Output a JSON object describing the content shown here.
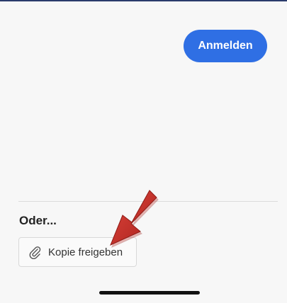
{
  "header": {
    "signin_label": "Anmelden"
  },
  "share_section": {
    "or_label": "Oder...",
    "share_copy_label": "Kopie freigeben",
    "share_icon": "paperclip-icon"
  },
  "annotation": {
    "arrow_color": "#c8332c",
    "arrow_icon": "red-arrow-annotation"
  },
  "colors": {
    "accent": "#2f6fe4",
    "background": "#f7f7f7"
  }
}
